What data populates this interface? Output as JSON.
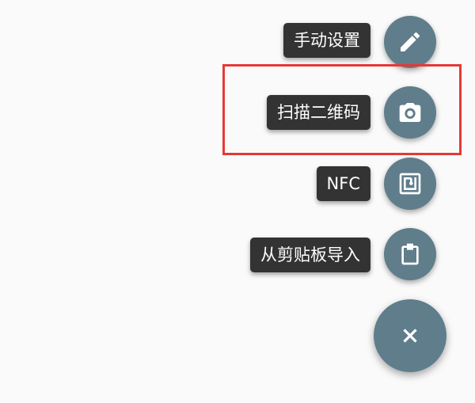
{
  "fab_menu": {
    "items": [
      {
        "label": "手动设置",
        "icon": "pencil-icon"
      },
      {
        "label": "扫描二维码",
        "icon": "camera-icon"
      },
      {
        "label": "NFC",
        "icon": "nfc-icon"
      },
      {
        "label": "从剪贴板导入",
        "icon": "clipboard-icon"
      }
    ],
    "main_button_icon": "close-icon"
  },
  "colors": {
    "background": "#fafafa",
    "fab": "#607d8b",
    "label_background": "#333333",
    "label_text": "#ffffff",
    "highlight_border": "#e53935"
  }
}
